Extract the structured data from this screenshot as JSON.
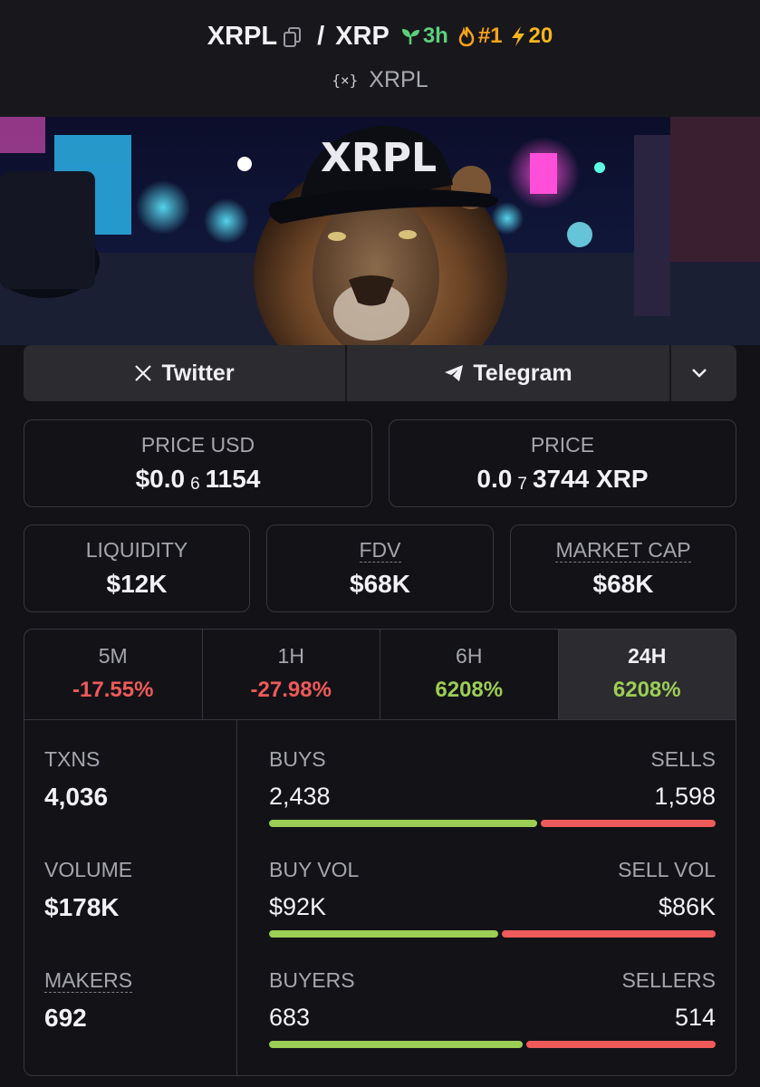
{
  "header": {
    "base_symbol": "XRPL",
    "separator": "/",
    "quote_symbol": "XRP",
    "age": "3h",
    "rank": "#1",
    "boosts": "20",
    "chain_icon": "{×}",
    "chain_name": "XRPL"
  },
  "banner": {
    "cap_text": "XRPL"
  },
  "social": {
    "twitter": "Twitter",
    "telegram": "Telegram"
  },
  "price": {
    "usd_label": "PRICE USD",
    "usd_prefix": "$0.0",
    "usd_zeros": "6",
    "usd_digits": "1154",
    "native_label": "PRICE",
    "native_prefix": "0.0",
    "native_zeros": "7",
    "native_digits": "3744 XRP"
  },
  "metrics": {
    "liquidity_label": "LIQUIDITY",
    "liquidity_value": "$12K",
    "fdv_label": "FDV",
    "fdv_value": "$68K",
    "mcap_label": "MARKET CAP",
    "mcap_value": "$68K"
  },
  "timeframes": [
    {
      "label": "5M",
      "change": "-17.55%"
    },
    {
      "label": "1H",
      "change": "-27.98%"
    },
    {
      "label": "6H",
      "change": "6208%"
    },
    {
      "label": "24H",
      "change": "6208%"
    }
  ],
  "stats": {
    "txns_label": "TXNS",
    "txns_value": "4,036",
    "volume_label": "VOLUME",
    "volume_value": "$178K",
    "makers_label": "MAKERS",
    "makers_value": "692",
    "buys_label": "BUYS",
    "buys_value": "2,438",
    "sells_label": "SELLS",
    "sells_value": "1,598",
    "buys_fraction": 0.604,
    "buyvol_label": "BUY VOL",
    "buyvol_value": "$92K",
    "sellvol_label": "SELL VOL",
    "sellvol_value": "$86K",
    "buyvol_fraction": 0.517,
    "buyers_label": "BUYERS",
    "buyers_value": "683",
    "sellers_label": "SELLERS",
    "sellers_value": "514",
    "buyers_fraction": 0.571
  },
  "colors": {
    "background": "#131317",
    "positive": "#9ccd55",
    "negative": "#ef5a5a",
    "age_green": "#5fcf7b",
    "rank_orange": "#f7a21b"
  }
}
